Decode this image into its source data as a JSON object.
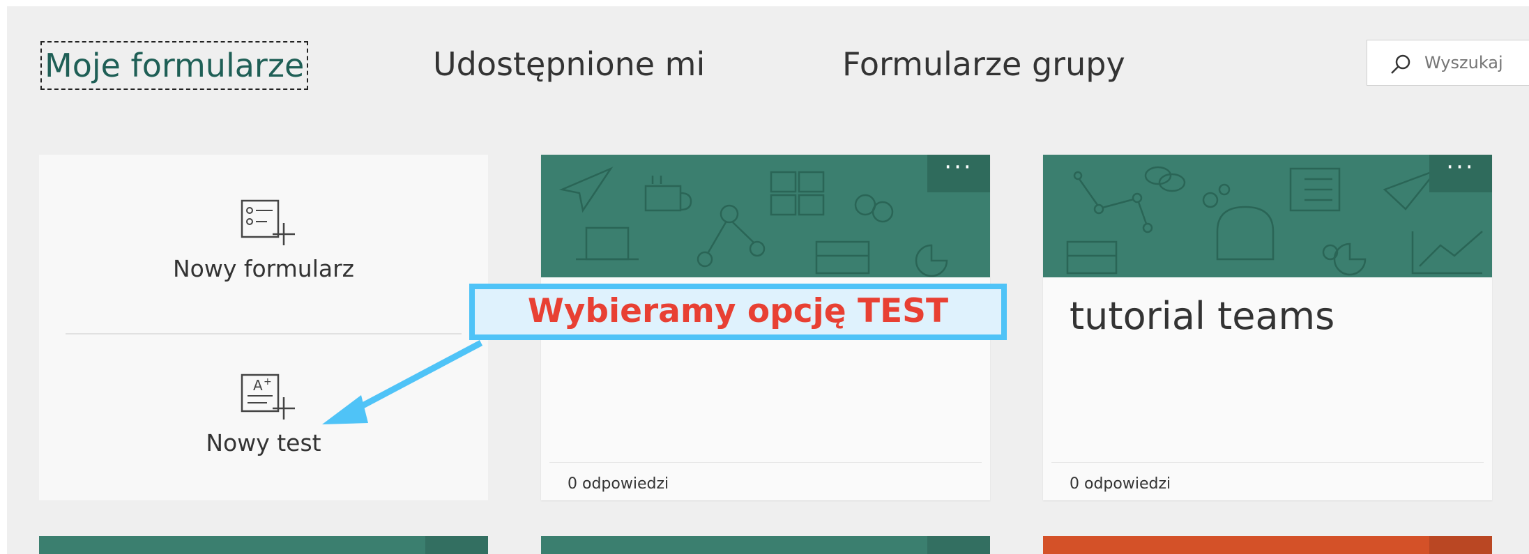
{
  "tabs": [
    {
      "label": "Moje formularze",
      "active": true
    },
    {
      "label": "Udostępnione mi",
      "active": false
    },
    {
      "label": "Formularze grupy",
      "active": false
    }
  ],
  "search": {
    "placeholder": "Wyszukaj",
    "icon": "search-icon"
  },
  "new_options": {
    "form_label": "Nowy formularz",
    "form_icon": "new-form-icon",
    "test_label": "Nowy test",
    "test_icon": "new-quiz-icon"
  },
  "cards": [
    {
      "title": "",
      "responses": "0 odpowiedzi",
      "color": "#3b7f6f",
      "more": "···"
    },
    {
      "title": "tutorial teams",
      "responses": "0 odpowiedzi",
      "color": "#3b7f6f",
      "more": "···"
    }
  ],
  "bottom_cards": [
    {
      "color": "#3b7f6f"
    },
    {
      "color": "#3b7f6f"
    },
    {
      "color": "#d45128"
    }
  ],
  "annotation": {
    "text": "Wybieramy opcję TEST",
    "text_color": "#e84033",
    "border_color": "#4fc3f7"
  },
  "colors": {
    "accent": "#3b7f6f",
    "background": "#efefef"
  }
}
